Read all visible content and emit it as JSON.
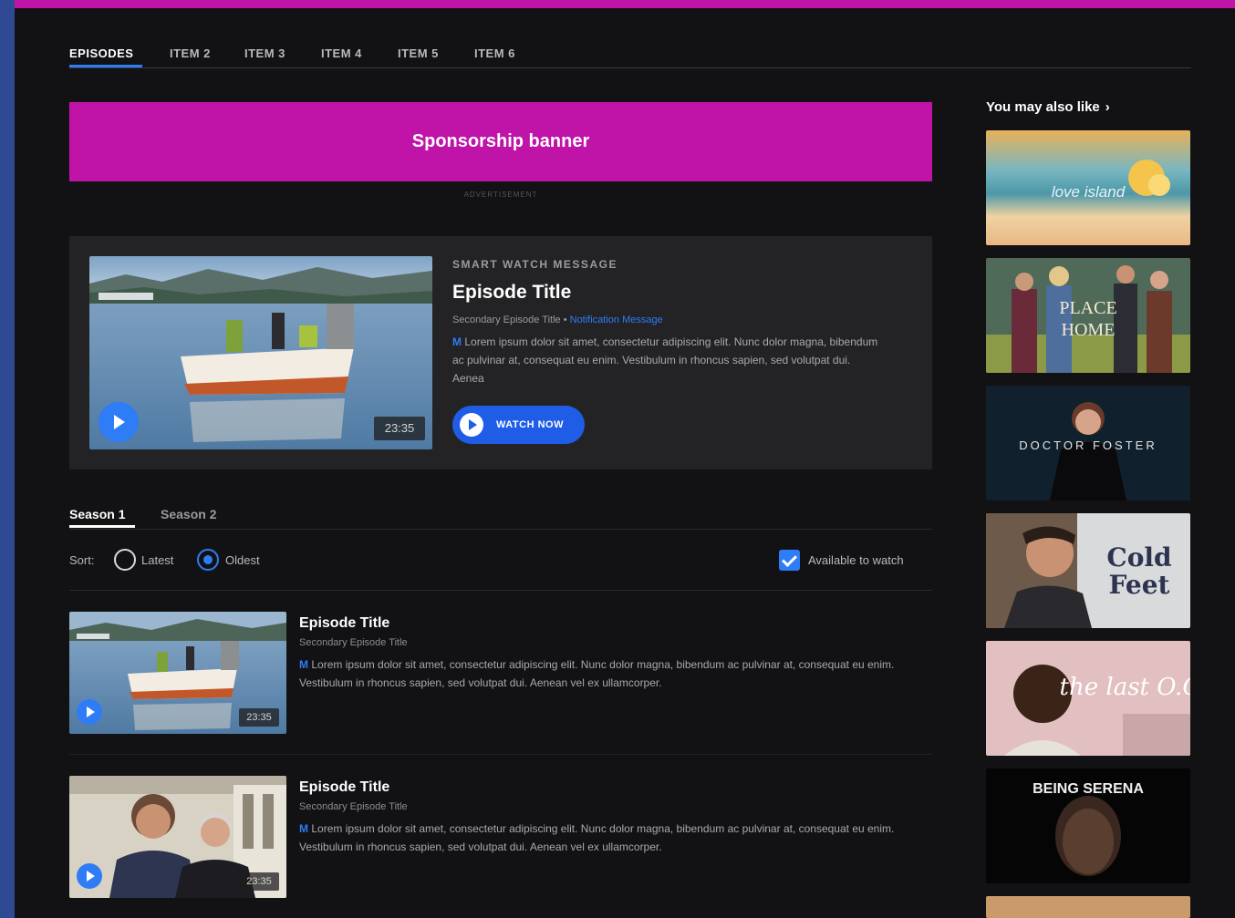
{
  "colors": {
    "accent": "#c013a8",
    "blue": "#2e7cf6",
    "background": "#121214",
    "card": "#232325"
  },
  "tabs": [
    "EPISODES",
    "ITEM 2",
    "ITEM 3",
    "ITEM 4",
    "ITEM 5",
    "ITEM 6"
  ],
  "sponsor": {
    "label": "Sponsorship banner",
    "ad_label": "ADVERTISEMENT"
  },
  "featured": {
    "smart_watch_message": "SMART WATCH MESSAGE",
    "title": "Episode Title",
    "secondary_title": "Secondary Episode Title",
    "separator": "•",
    "notification": "Notification Message",
    "rating": "M",
    "description": "Lorem ipsum dolor sit amet, consectetur adipiscing elit. Nunc dolor magna, bibendum ac pulvinar at, consequat eu enim. Vestibulum in rhoncus sapien, sed volutpat dui. Aenea",
    "duration": "23:35",
    "watch_now": "WATCH NOW",
    "play_icon": "play-icon"
  },
  "seasons": [
    "Season 1",
    "Season 2"
  ],
  "sort": {
    "label": "Sort:",
    "options": [
      "Latest",
      "Oldest"
    ],
    "selected": "Oldest",
    "available_label": "Available to watch",
    "available_checked": true
  },
  "episodes": [
    {
      "title": "Episode Title",
      "secondary": "Secondary Episode Title",
      "rating": "M",
      "description": "Lorem ipsum dolor sit amet, consectetur adipiscing elit. Nunc dolor magna, bibendum ac pulvinar at, consequat eu enim. Vestibulum in rhoncus sapien, sed volutpat dui. Aenean vel ex ullamcorper.",
      "duration": "23:35"
    },
    {
      "title": "Episode Title",
      "secondary": "Secondary Episode Title",
      "rating": "M",
      "description": "Lorem ipsum dolor sit amet, consectetur adipiscing elit. Nunc dolor magna, bibendum ac pulvinar at, consequat eu enim. Vestibulum in rhoncus sapien, sed volutpat dui. Aenean vel ex ullamcorper.",
      "duration": "23:35"
    }
  ],
  "rail": {
    "heading": "You may also like",
    "chevron": "›",
    "tiles": [
      {
        "name": "love-island-tile",
        "text": "love island"
      },
      {
        "name": "a-place-to-call-home-tile",
        "text_top": "PLACE",
        "text_bottom": "HOME"
      },
      {
        "name": "doctor-foster-tile",
        "text": "DOCTOR FOSTER"
      },
      {
        "name": "cold-feet-tile",
        "text_top": "Cold",
        "text_bottom": "Feet"
      },
      {
        "name": "the-last-og-tile",
        "text": "the last O.G."
      },
      {
        "name": "being-serena-tile",
        "text": "BEING SERENA"
      }
    ]
  }
}
